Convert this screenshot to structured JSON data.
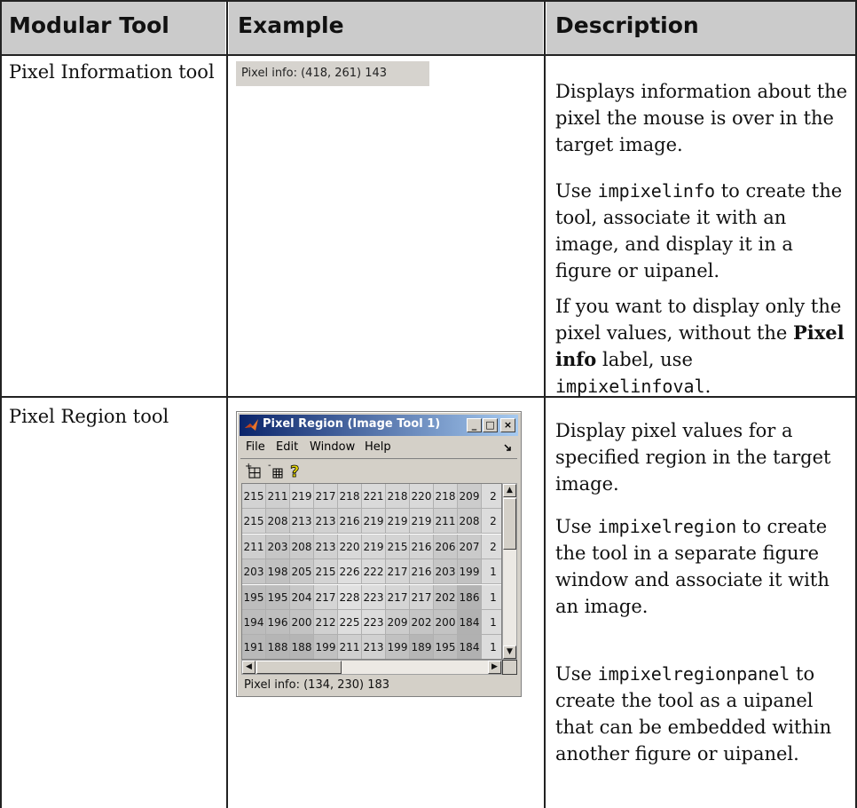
{
  "headers": [
    "Modular Tool",
    "Example",
    "Description"
  ],
  "rows": [
    {
      "tool": "Pixel Information tool",
      "example_text": "Pixel info: (418, 261)  143",
      "paragraphs": [
        {
          "text": "Displays information about the pixel the mouse is over in the target image."
        },
        {
          "pre": "Use ",
          "code": "impixelinfo",
          "post": " to create the tool, associate it with an image, and display it in a figure or uipanel."
        },
        {
          "pre": "If you want to display only the pixel values, without the ",
          "bold": "Pixel info",
          "mid": " label, use ",
          "code": "impixelinfoval",
          "post": "."
        }
      ]
    },
    {
      "tool": "Pixel Region tool",
      "paragraphs": [
        {
          "text": "Display pixel values for a specified region in the target image."
        },
        {
          "code": "impixelregion",
          "pre": "Use ",
          "post": " to create the tool in a separate figure window and associate it with an image."
        },
        {
          "code": "impixelregionpanel",
          "pre": "Use ",
          "post": " to create the tool as a uipanel that can be embedded within another figure or uipanel."
        }
      ]
    }
  ],
  "window": {
    "title": "Pixel Region (Image Tool 1)",
    "title_buttons": [
      "_",
      "□",
      "×"
    ],
    "menus": [
      "File",
      "Edit",
      "Window",
      "Help"
    ],
    "toolbar_icons": [
      "zoom-in-grid-icon",
      "zoom-out-grid-icon",
      "help-question-icon"
    ],
    "grid": [
      [
        "215",
        "211",
        "219",
        "217",
        "218",
        "221",
        "218",
        "220",
        "218",
        "209",
        "2"
      ],
      [
        "215",
        "208",
        "213",
        "213",
        "216",
        "219",
        "219",
        "219",
        "211",
        "208",
        "2"
      ],
      [
        "211",
        "203",
        "208",
        "213",
        "220",
        "219",
        "215",
        "216",
        "206",
        "207",
        "2"
      ],
      [
        "203",
        "198",
        "205",
        "215",
        "226",
        "222",
        "217",
        "216",
        "203",
        "199",
        "1"
      ],
      [
        "195",
        "195",
        "204",
        "217",
        "228",
        "223",
        "217",
        "217",
        "202",
        "186",
        "1"
      ],
      [
        "194",
        "196",
        "200",
        "212",
        "225",
        "223",
        "209",
        "202",
        "200",
        "184",
        "1"
      ],
      [
        "191",
        "188",
        "188",
        "199",
        "211",
        "213",
        "199",
        "189",
        "195",
        "184",
        "1"
      ]
    ],
    "status": "Pixel info: (134, 230)  183"
  },
  "colors": {
    "header_bg": "#cbcbcb",
    "title_bar_start": "#0a246a",
    "title_bar_end": "#a6caf0"
  }
}
